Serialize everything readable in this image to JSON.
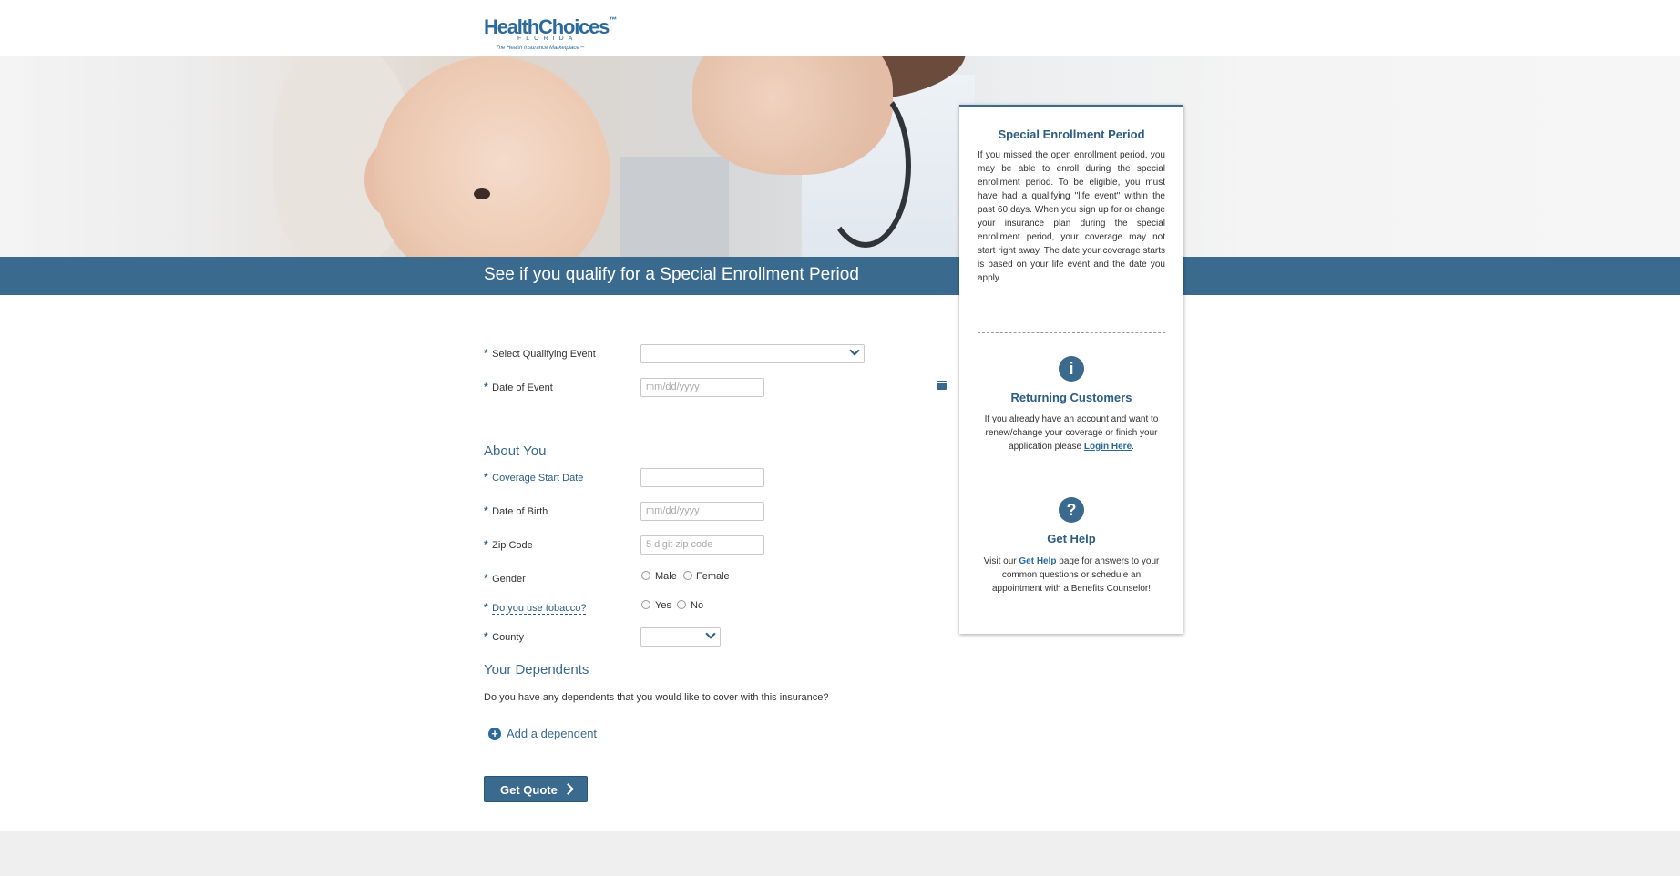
{
  "header": {
    "logo": {
      "name": "HealthChoices",
      "state": "FLORIDA",
      "tagline": "The Health Insurance Marketplace™"
    }
  },
  "banner": {
    "title": "See if you qualify for a Special Enrollment Period"
  },
  "form": {
    "required_marker": "*",
    "qualifying_event": {
      "label": "Select Qualifying Event",
      "value": ""
    },
    "date_of_event": {
      "label": "Date of Event",
      "placeholder": "mm/dd/yyyy"
    },
    "about_you": {
      "title": "About You",
      "coverage_start": {
        "label": "Coverage Start Date",
        "value": ""
      },
      "dob": {
        "label": "Date of Birth",
        "placeholder": "mm/dd/yyyy"
      },
      "zip": {
        "label": "Zip Code",
        "placeholder": "5 digit zip code"
      },
      "gender": {
        "label": "Gender",
        "options": [
          "Male",
          "Female"
        ]
      },
      "tobacco": {
        "label": "Do you use tobacco?",
        "options": [
          "Yes",
          "No"
        ]
      },
      "county": {
        "label": "County",
        "value": ""
      }
    },
    "dependents": {
      "title": "Your Dependents",
      "question": "Do you have any dependents that you would like to cover with this insurance?",
      "add_label": "Add a dependent"
    },
    "submit_label": "Get Quote"
  },
  "sidebar": {
    "sep": {
      "title": "Special Enrollment Period",
      "text": "If you missed the open enrollment period, you may be able to enroll during the special enrollment period. To be eligible, you must have had a qualifying \"life event\" within the past 60 days. When you sign up for or change your insurance plan during the special enrollment period, your coverage may not start right away. The date your coverage starts is based on your life event and the date you apply."
    },
    "returning": {
      "icon": "i",
      "title": "Returning Customers",
      "text_before": "If you already have an account and want to renew/change your coverage or finish your application please ",
      "link": "Login Here",
      "text_after": "."
    },
    "help": {
      "icon": "?",
      "title": "Get Help",
      "text_before": "Visit our ",
      "link": "Get Help",
      "text_after": " page for answers to your common questions or schedule an appointment with a Benefits Counselor!"
    }
  },
  "colors": {
    "brand_blue": "#3a6a8e",
    "logo_yellow": "#f2cf00",
    "footer_gray": "#efefef"
  }
}
